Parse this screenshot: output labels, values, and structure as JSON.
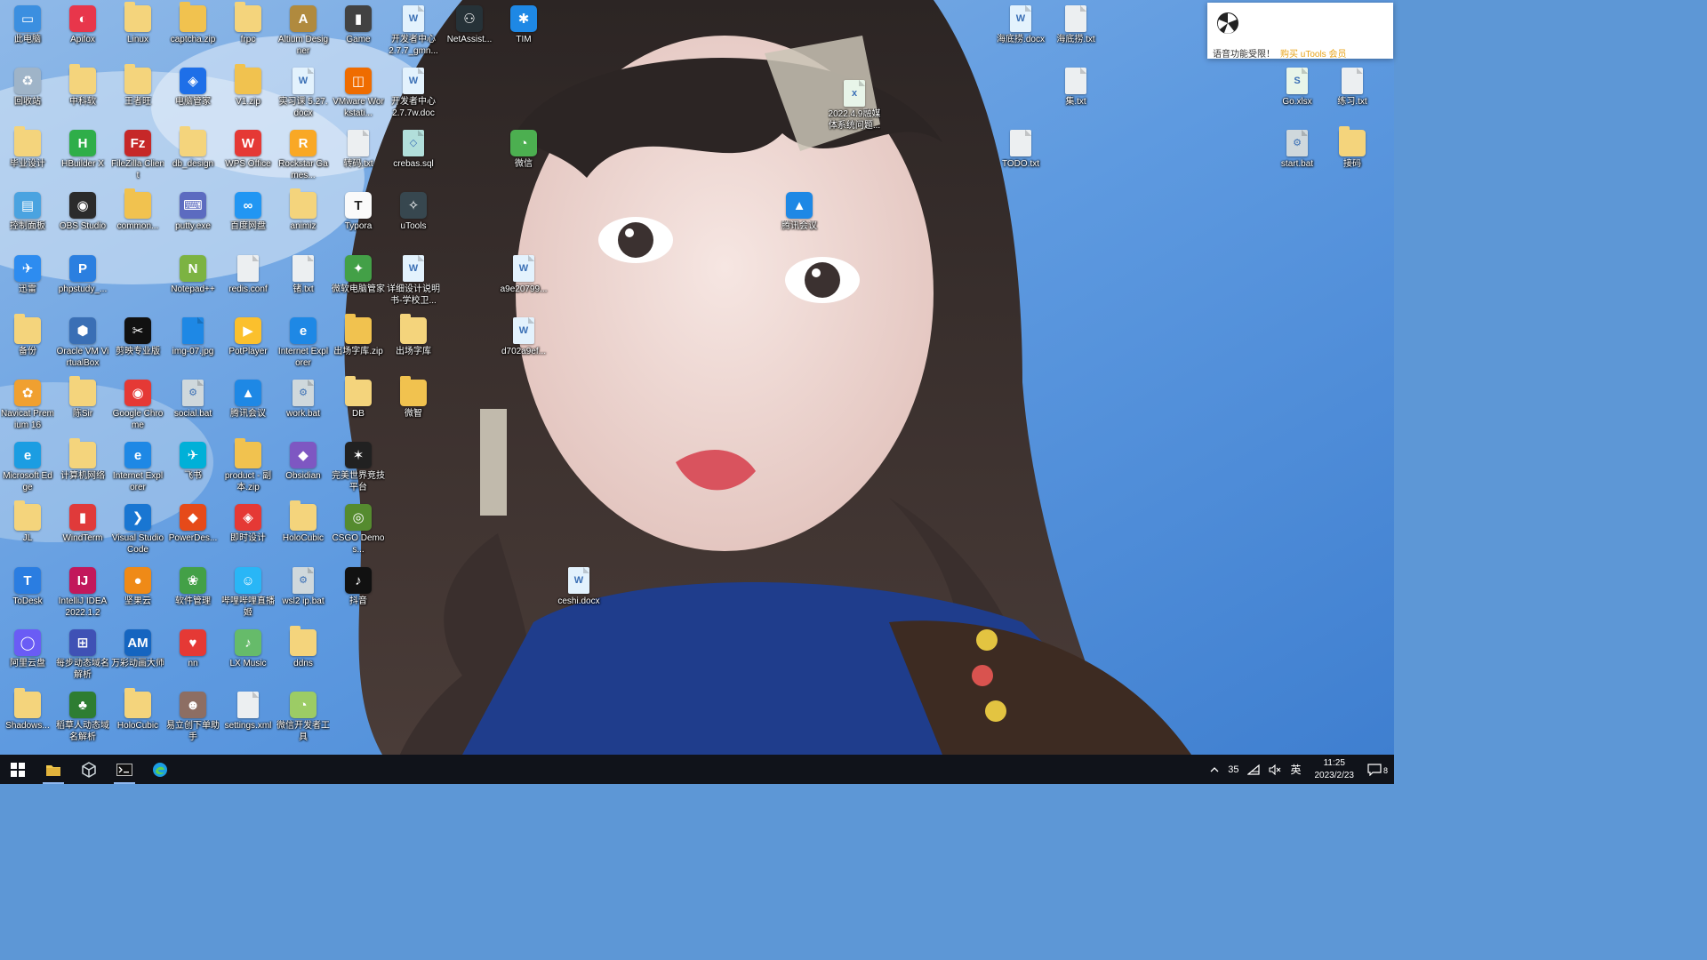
{
  "desktop": {
    "icons": [
      {
        "label": "此电脑",
        "kind": "app",
        "icon": "computer-icon",
        "color": "#3b8fe0",
        "glyph": "▭"
      },
      {
        "label": "回收站",
        "kind": "app",
        "icon": "recycle-bin-icon",
        "color": "#9fb4c8",
        "glyph": "♻"
      },
      {
        "label": "毕业设计",
        "kind": "folder",
        "icon": "folder-icon",
        "color": "#f4d47c",
        "glyph": ""
      },
      {
        "label": "控制面板",
        "kind": "app",
        "icon": "control-panel-icon",
        "color": "#4aa3e0",
        "glyph": "▤"
      },
      {
        "label": "迅雷",
        "kind": "app",
        "icon": "thunder-icon",
        "color": "#2d8cf0",
        "glyph": "✈"
      },
      {
        "label": "备份",
        "kind": "folder",
        "icon": "folder-icon",
        "color": "#f4d47c",
        "glyph": ""
      },
      {
        "label": "Navicat Premium 16",
        "kind": "app",
        "icon": "navicat-icon",
        "color": "#f0a030",
        "glyph": "✿"
      },
      {
        "label": "Microsoft Edge",
        "kind": "app",
        "icon": "edge-icon",
        "color": "#1b9de2",
        "glyph": "e"
      },
      {
        "label": "JL",
        "kind": "folder",
        "icon": "folder-icon",
        "color": "#f4d47c",
        "glyph": ""
      },
      {
        "label": "ToDesk",
        "kind": "app",
        "icon": "todesk-icon",
        "color": "#2a7de1",
        "glyph": "T"
      },
      {
        "label": "阿里云盘",
        "kind": "app",
        "icon": "aliyun-drive-icon",
        "color": "#6a5cf5",
        "glyph": "◯"
      },
      {
        "label": "Shadows...",
        "kind": "folder",
        "icon": "folder-icon",
        "color": "#f4d47c",
        "glyph": ""
      },
      {
        "label": "Apifox",
        "kind": "app",
        "icon": "apifox-icon",
        "color": "#e8364b",
        "glyph": "◐"
      },
      {
        "label": "中科软",
        "kind": "folder",
        "icon": "folder-icon",
        "color": "#f4d47c",
        "glyph": ""
      },
      {
        "label": "HBuilder X",
        "kind": "app",
        "icon": "hbuilder-icon",
        "color": "#2fae49",
        "glyph": "H"
      },
      {
        "label": "OBS Studio",
        "kind": "app",
        "icon": "obs-icon",
        "color": "#2b2b2b",
        "glyph": "◉"
      },
      {
        "label": "phpstudy_...",
        "kind": "app",
        "icon": "phpstudy-icon",
        "color": "#2b7fe0",
        "glyph": "P"
      },
      {
        "label": "Oracle VM VirtualBox",
        "kind": "app",
        "icon": "virtualbox-icon",
        "color": "#3a6fb5",
        "glyph": "⬢"
      },
      {
        "label": "陈Sir",
        "kind": "folder",
        "icon": "folder-icon",
        "color": "#f4d47c",
        "glyph": ""
      },
      {
        "label": "计算机网络",
        "kind": "folder",
        "icon": "folder-icon",
        "color": "#f4d47c",
        "glyph": ""
      },
      {
        "label": "WindTerm",
        "kind": "app",
        "icon": "windterm-icon",
        "color": "#e03a3a",
        "glyph": "▮"
      },
      {
        "label": "IntelliJ IDEA 2022.1.2",
        "kind": "app",
        "icon": "intellij-icon",
        "color": "#c2185b",
        "glyph": "IJ"
      },
      {
        "label": "每步动态域名解析",
        "kind": "app",
        "icon": "ddns-icon",
        "color": "#3f51b5",
        "glyph": "⊞"
      },
      {
        "label": "稻草人动态域名解析",
        "kind": "app",
        "icon": "tree-icon",
        "color": "#2e7d32",
        "glyph": "♣"
      },
      {
        "label": "Linux",
        "kind": "folder",
        "icon": "folder-icon",
        "color": "#f4d47c",
        "glyph": ""
      },
      {
        "label": "王者旺",
        "kind": "folder",
        "icon": "folder-icon",
        "color": "#f4d47c",
        "glyph": ""
      },
      {
        "label": "FileZilla Client",
        "kind": "app",
        "icon": "filezilla-icon",
        "color": "#c62828",
        "glyph": "Fz"
      },
      {
        "label": "common...",
        "kind": "folder",
        "icon": "folder-icon",
        "color": "#f1c24f",
        "glyph": ""
      },
      {
        "label": "剪映专业版",
        "kind": "app",
        "icon": "capcut-icon",
        "color": "#111111",
        "glyph": "✂"
      },
      {
        "label": "Google Chrome",
        "kind": "app",
        "icon": "chrome-icon",
        "color": "#e53935",
        "glyph": "◉"
      },
      {
        "label": "Internet Explorer",
        "kind": "app",
        "icon": "ie-icon",
        "color": "#1e88e5",
        "glyph": "e"
      },
      {
        "label": "Visual Studio Code",
        "kind": "app",
        "icon": "vscode-icon",
        "color": "#1976d2",
        "glyph": "❯"
      },
      {
        "label": "坚果云",
        "kind": "app",
        "icon": "jianguoyun-icon",
        "color": "#ef8a17",
        "glyph": "●"
      },
      {
        "label": "万彩动画大师",
        "kind": "app",
        "icon": "animation-icon",
        "color": "#1565c0",
        "glyph": "AM"
      },
      {
        "label": "HoloCubic",
        "kind": "folder",
        "icon": "folder-icon",
        "color": "#f4d47c",
        "glyph": ""
      },
      {
        "label": "captcha.zip",
        "kind": "folder",
        "icon": "zip-folder-icon",
        "color": "#f1c24f",
        "glyph": ""
      },
      {
        "label": "电脑管家",
        "kind": "app",
        "icon": "pc-manager-icon",
        "color": "#1e6fe8",
        "glyph": "◈"
      },
      {
        "label": "db_design",
        "kind": "folder",
        "icon": "folder-icon",
        "color": "#f4d47c",
        "glyph": ""
      },
      {
        "label": "putty.exe",
        "kind": "app",
        "icon": "putty-icon",
        "color": "#5c6bc0",
        "glyph": "⌨"
      },
      {
        "label": "Notepad++",
        "kind": "app",
        "icon": "notepadpp-icon",
        "color": "#7cb342",
        "glyph": "N"
      },
      {
        "label": "img-07.jpg",
        "kind": "file",
        "icon": "image-file-icon",
        "color": "#1e88e5",
        "glyph": ""
      },
      {
        "label": "social.bat",
        "kind": "file",
        "icon": "bat-file-icon",
        "color": "#cfd8dc",
        "glyph": "⚙"
      },
      {
        "label": "飞书",
        "kind": "app",
        "icon": "feishu-icon",
        "color": "#00b0d8",
        "glyph": "✈"
      },
      {
        "label": "PowerDes...",
        "kind": "app",
        "icon": "powerdesigner-icon",
        "color": "#e64a19",
        "glyph": "◆"
      },
      {
        "label": "软件管理",
        "kind": "app",
        "icon": "software-manager-icon",
        "color": "#43a047",
        "glyph": "❀"
      },
      {
        "label": "nn",
        "kind": "app",
        "icon": "heart-icon",
        "color": "#e53935",
        "glyph": "♥"
      },
      {
        "label": "易立创下单助手",
        "kind": "app",
        "icon": "bear-icon",
        "color": "#8d6e63",
        "glyph": "☻"
      },
      {
        "label": "frpc",
        "kind": "folder",
        "icon": "folder-icon",
        "color": "#f4d47c",
        "glyph": ""
      },
      {
        "label": "V1.zip",
        "kind": "folder",
        "icon": "zip-folder-icon",
        "color": "#f1c24f",
        "glyph": ""
      },
      {
        "label": "WPS Office",
        "kind": "app",
        "icon": "wps-icon",
        "color": "#e53935",
        "glyph": "W"
      },
      {
        "label": "百度网盘",
        "kind": "app",
        "icon": "baidu-drive-icon",
        "color": "#2196f3",
        "glyph": "∞"
      },
      {
        "label": "redis.conf",
        "kind": "file",
        "icon": "text-file-icon",
        "color": "#eceff1",
        "glyph": ""
      },
      {
        "label": "PotPlayer",
        "kind": "app",
        "icon": "potplayer-icon",
        "color": "#fbc02d",
        "glyph": "▶"
      },
      {
        "label": "腾讯会议",
        "kind": "app",
        "icon": "tencent-meeting-icon",
        "color": "#1e88e5",
        "glyph": "▲"
      },
      {
        "label": "product - 副本.zip",
        "kind": "folder",
        "icon": "zip-folder-icon",
        "color": "#f1c24f",
        "glyph": ""
      },
      {
        "label": "即时设计",
        "kind": "app",
        "icon": "jsdesign-icon",
        "color": "#e53935",
        "glyph": "◈"
      },
      {
        "label": "哔哩哔哩直播姬",
        "kind": "app",
        "icon": "bilibili-live-icon",
        "color": "#29b6f6",
        "glyph": "☺"
      },
      {
        "label": "LX Music",
        "kind": "app",
        "icon": "lxmusic-icon",
        "color": "#66bb6a",
        "glyph": "♪"
      },
      {
        "label": "settings.xml",
        "kind": "file",
        "icon": "xml-file-icon",
        "color": "#eceff1",
        "glyph": ""
      },
      {
        "label": "Altium Designer",
        "kind": "app",
        "icon": "altium-icon",
        "color": "#b08a3e",
        "glyph": "A"
      },
      {
        "label": "实习课 5.27.docx",
        "kind": "file",
        "icon": "word-file-icon",
        "color": "#e3f2fd",
        "glyph": "W"
      },
      {
        "label": "Rockstar Games...",
        "kind": "app",
        "icon": "rockstar-icon",
        "color": "#f9a825",
        "glyph": "R"
      },
      {
        "label": "animiz",
        "kind": "folder",
        "icon": "folder-icon",
        "color": "#f4d47c",
        "glyph": ""
      },
      {
        "label": "锗.txt",
        "kind": "file",
        "icon": "text-file-icon",
        "color": "#eceff1",
        "glyph": ""
      },
      {
        "label": "Internet Explorer",
        "kind": "app",
        "icon": "ie-icon",
        "color": "#1e88e5",
        "glyph": "e"
      },
      {
        "label": "work.bat",
        "kind": "file",
        "icon": "bat-file-icon",
        "color": "#cfd8dc",
        "glyph": "⚙"
      },
      {
        "label": "Obsidian",
        "kind": "app",
        "icon": "obsidian-icon",
        "color": "#7e57c2",
        "glyph": "◆"
      },
      {
        "label": "HoloCubic",
        "kind": "folder",
        "icon": "folder-icon",
        "color": "#f4d47c",
        "glyph": ""
      },
      {
        "label": "wsl2 ip.bat",
        "kind": "file",
        "icon": "bat-file-icon",
        "color": "#cfd8dc",
        "glyph": "⚙"
      },
      {
        "label": "ddns",
        "kind": "folder",
        "icon": "folder-icon",
        "color": "#f4d47c",
        "glyph": ""
      },
      {
        "label": "微信开发者工具",
        "kind": "app",
        "icon": "wechat-devtools-icon",
        "color": "#9ccc65",
        "glyph": "◔"
      },
      {
        "label": "Game",
        "kind": "app",
        "icon": "game-icon",
        "color": "#424242",
        "glyph": "▮"
      },
      {
        "label": "VMware Workstati...",
        "kind": "app",
        "icon": "vmware-icon",
        "color": "#ef6c00",
        "glyph": "◫"
      },
      {
        "label": "转码.txt",
        "kind": "file",
        "icon": "text-file-icon",
        "color": "#eceff1",
        "glyph": ""
      },
      {
        "label": "Typora",
        "kind": "app",
        "icon": "typora-icon",
        "color": "#fafafa",
        "glyph": "T"
      },
      {
        "label": "微软电脑管家",
        "kind": "app",
        "icon": "ms-pc-manager-icon",
        "color": "#43a047",
        "glyph": "✦"
      },
      {
        "label": "出场字库.zip",
        "kind": "folder",
        "icon": "zip-folder-icon",
        "color": "#f1c24f",
        "glyph": ""
      },
      {
        "label": "DB",
        "kind": "folder",
        "icon": "folder-icon",
        "color": "#f4d47c",
        "glyph": ""
      },
      {
        "label": "完美世界竞技平台",
        "kind": "app",
        "icon": "perfect-world-icon",
        "color": "#212121",
        "glyph": "✶"
      },
      {
        "label": "CSGO Demos...",
        "kind": "app",
        "icon": "csgo-icon",
        "color": "#558b2f",
        "glyph": "◎"
      },
      {
        "label": "抖音",
        "kind": "app",
        "icon": "douyin-icon",
        "color": "#111111",
        "glyph": "♪"
      },
      {
        "label": "开发者中心 2.7.7_gmn...",
        "kind": "file",
        "icon": "word-file-icon",
        "color": "#e3f2fd",
        "glyph": "W"
      },
      {
        "label": "开发者中心 2.7.7w.doc",
        "kind": "file",
        "icon": "word-file-icon",
        "color": "#e3f2fd",
        "glyph": "W"
      },
      {
        "label": "crebas.sql",
        "kind": "file",
        "icon": "sql-file-icon",
        "color": "#b2dfdb",
        "glyph": "◇"
      },
      {
        "label": "uTools",
        "kind": "app",
        "icon": "utools-icon",
        "color": "#37474f",
        "glyph": "✧"
      },
      {
        "label": "详细设计说明书-学校卫...",
        "kind": "file",
        "icon": "word-file-icon",
        "color": "#e3f2fd",
        "glyph": "W"
      },
      {
        "label": "出场字库",
        "kind": "folder",
        "icon": "folder-icon",
        "color": "#f4d47c",
        "glyph": ""
      },
      {
        "label": "微智",
        "kind": "folder",
        "icon": "folder-icon",
        "color": "#f1c24f",
        "glyph": ""
      },
      {
        "label": "NetAssist...",
        "kind": "app",
        "icon": "netassist-icon",
        "color": "#263238",
        "glyph": "⚇"
      },
      {
        "label": "TIM",
        "kind": "app",
        "icon": "tim-icon",
        "color": "#1e88e5",
        "glyph": "✱"
      },
      {
        "label": "微信",
        "kind": "app",
        "icon": "wechat-icon",
        "color": "#4caf50",
        "glyph": "◔"
      },
      {
        "label": "a9e20799...",
        "kind": "file",
        "icon": "word-file-icon",
        "color": "#e3f2fd",
        "glyph": "W"
      },
      {
        "label": "d702a9ef...",
        "kind": "file",
        "icon": "word-file-icon",
        "color": "#e3f2fd",
        "glyph": "W"
      },
      {
        "label": "ceshi.docx",
        "kind": "file",
        "icon": "word-file-icon",
        "color": "#e3f2fd",
        "glyph": "W"
      },
      {
        "label": "腾讯会议",
        "kind": "app",
        "icon": "tencent-meeting-icon",
        "color": "#1e88e5",
        "glyph": "▲"
      },
      {
        "label": "2022.4.9融媒体系统问题...",
        "kind": "file",
        "icon": "excel-file-icon",
        "color": "#e8f5e9",
        "glyph": "x"
      },
      {
        "label": "海底捞.docx",
        "kind": "file",
        "icon": "word-file-icon",
        "color": "#e3f2fd",
        "glyph": "W"
      },
      {
        "label": "TODO.txt",
        "kind": "file",
        "icon": "text-file-icon",
        "color": "#eceff1",
        "glyph": ""
      },
      {
        "label": "海底捞.txt",
        "kind": "file",
        "icon": "text-file-icon",
        "color": "#eceff1",
        "glyph": ""
      },
      {
        "label": "集.txt",
        "kind": "file",
        "icon": "text-file-icon",
        "color": "#eceff1",
        "glyph": ""
      },
      {
        "label": "Go.xlsx",
        "kind": "file",
        "icon": "excel-file-icon",
        "color": "#e8f5e9",
        "glyph": "S"
      },
      {
        "label": "start.bat",
        "kind": "file",
        "icon": "bat-file-icon",
        "color": "#cfd8dc",
        "glyph": "⚙"
      },
      {
        "label": "练习.txt",
        "kind": "file",
        "icon": "text-file-icon",
        "color": "#eceff1",
        "glyph": ""
      },
      {
        "label": "接码",
        "kind": "folder",
        "icon": "folder-icon",
        "color": "#f4d47c",
        "glyph": ""
      }
    ]
  },
  "notification": {
    "message": "语音功能受限！",
    "link": "购买 uTools 会员"
  },
  "taskbar": {
    "start": "windows-start-icon",
    "pinned": [
      {
        "name": "file-explorer-icon",
        "active": true
      },
      {
        "name": "virtualbox-taskbar-icon",
        "active": false
      },
      {
        "name": "terminal-icon",
        "active": true
      },
      {
        "name": "edge-taskbar-icon",
        "active": false
      }
    ],
    "tray": {
      "temperature": "35",
      "ime": "英",
      "time": "11:25",
      "date": "2023/2/23",
      "notification_count": "8"
    }
  }
}
